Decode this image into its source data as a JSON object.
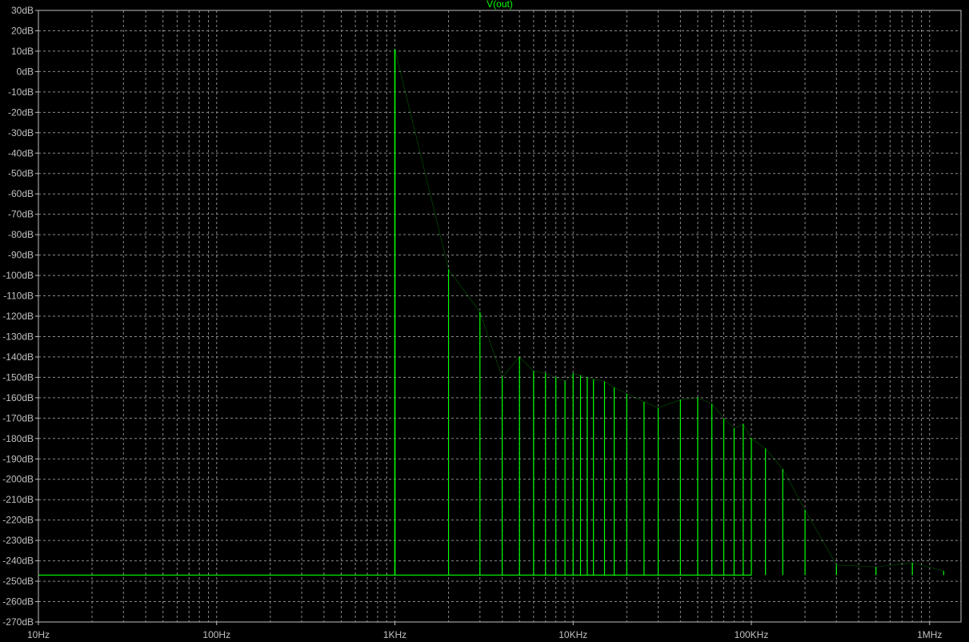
{
  "window": {
    "background": "#000000"
  },
  "chart_data": {
    "type": "line",
    "title": "V(out)",
    "x_scale": "log",
    "xlim": [
      10,
      1500000
    ],
    "ylim": [
      -270,
      30
    ],
    "grid": true,
    "x_ticks": [
      10,
      100,
      1000,
      10000,
      100000,
      1000000
    ],
    "x_tick_labels": [
      "10Hz",
      "100Hz",
      "1KHz",
      "10KHz",
      "100KHz",
      "1MHz"
    ],
    "y_ticks": [
      30,
      20,
      10,
      0,
      -10,
      -20,
      -30,
      -40,
      -50,
      -60,
      -70,
      -80,
      -90,
      -100,
      -110,
      -120,
      -130,
      -140,
      -150,
      -160,
      -170,
      -180,
      -190,
      -200,
      -210,
      -220,
      -230,
      -240,
      -250,
      -260,
      -270
    ],
    "y_tick_labels": [
      "30dB",
      "20dB",
      "10dB",
      "0dB",
      "-10dB",
      "-20dB",
      "-30dB",
      "-40dB",
      "-50dB",
      "-60dB",
      "-70dB",
      "-80dB",
      "-90dB",
      "-100dB",
      "-110dB",
      "-120dB",
      "-130dB",
      "-140dB",
      "-150dB",
      "-160dB",
      "-170dB",
      "-180dB",
      "-190dB",
      "-200dB",
      "-210dB",
      "-220dB",
      "-230dB",
      "-240dB",
      "-250dB",
      "-260dB",
      "-270dB"
    ],
    "colors": {
      "trace": "#00ff00",
      "axis": "#c0c0c0",
      "grid": "#8a8a8a"
    },
    "noise_floor_db": -247,
    "series": [
      {
        "x_hz": [
          1000,
          2000,
          3000,
          4000,
          5000,
          6000,
          7000,
          8000,
          9000,
          10000,
          11000,
          12000,
          13000,
          15000,
          17000,
          20000,
          25000,
          30000,
          40000,
          50000,
          60000,
          70000,
          80000,
          90000,
          100000,
          120000,
          150000,
          200000,
          300000,
          500000,
          800000,
          1200000
        ],
        "peak_db": [
          11,
          -97,
          -118,
          -150,
          -140,
          -147,
          -148,
          -150,
          -152,
          -148,
          -149,
          -150,
          -151,
          -152,
          -155,
          -158,
          -162,
          -165,
          -161,
          -160,
          -163,
          -170,
          -175,
          -173,
          -180,
          -185,
          -195,
          -215,
          -242,
          -243,
          -241,
          -245
        ]
      }
    ]
  }
}
